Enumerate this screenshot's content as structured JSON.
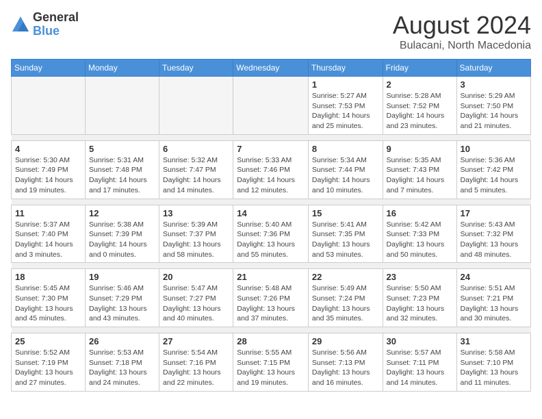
{
  "logo": {
    "general": "General",
    "blue": "Blue"
  },
  "title": "August 2024",
  "location": "Bulacani, North Macedonia",
  "days_of_week": [
    "Sunday",
    "Monday",
    "Tuesday",
    "Wednesday",
    "Thursday",
    "Friday",
    "Saturday"
  ],
  "weeks": [
    [
      {
        "day": "",
        "info": ""
      },
      {
        "day": "",
        "info": ""
      },
      {
        "day": "",
        "info": ""
      },
      {
        "day": "",
        "info": ""
      },
      {
        "day": "1",
        "info": "Sunrise: 5:27 AM\nSunset: 7:53 PM\nDaylight: 14 hours\nand 25 minutes."
      },
      {
        "day": "2",
        "info": "Sunrise: 5:28 AM\nSunset: 7:52 PM\nDaylight: 14 hours\nand 23 minutes."
      },
      {
        "day": "3",
        "info": "Sunrise: 5:29 AM\nSunset: 7:50 PM\nDaylight: 14 hours\nand 21 minutes."
      }
    ],
    [
      {
        "day": "4",
        "info": "Sunrise: 5:30 AM\nSunset: 7:49 PM\nDaylight: 14 hours\nand 19 minutes."
      },
      {
        "day": "5",
        "info": "Sunrise: 5:31 AM\nSunset: 7:48 PM\nDaylight: 14 hours\nand 17 minutes."
      },
      {
        "day": "6",
        "info": "Sunrise: 5:32 AM\nSunset: 7:47 PM\nDaylight: 14 hours\nand 14 minutes."
      },
      {
        "day": "7",
        "info": "Sunrise: 5:33 AM\nSunset: 7:46 PM\nDaylight: 14 hours\nand 12 minutes."
      },
      {
        "day": "8",
        "info": "Sunrise: 5:34 AM\nSunset: 7:44 PM\nDaylight: 14 hours\nand 10 minutes."
      },
      {
        "day": "9",
        "info": "Sunrise: 5:35 AM\nSunset: 7:43 PM\nDaylight: 14 hours\nand 7 minutes."
      },
      {
        "day": "10",
        "info": "Sunrise: 5:36 AM\nSunset: 7:42 PM\nDaylight: 14 hours\nand 5 minutes."
      }
    ],
    [
      {
        "day": "11",
        "info": "Sunrise: 5:37 AM\nSunset: 7:40 PM\nDaylight: 14 hours\nand 3 minutes."
      },
      {
        "day": "12",
        "info": "Sunrise: 5:38 AM\nSunset: 7:39 PM\nDaylight: 14 hours\nand 0 minutes."
      },
      {
        "day": "13",
        "info": "Sunrise: 5:39 AM\nSunset: 7:37 PM\nDaylight: 13 hours\nand 58 minutes."
      },
      {
        "day": "14",
        "info": "Sunrise: 5:40 AM\nSunset: 7:36 PM\nDaylight: 13 hours\nand 55 minutes."
      },
      {
        "day": "15",
        "info": "Sunrise: 5:41 AM\nSunset: 7:35 PM\nDaylight: 13 hours\nand 53 minutes."
      },
      {
        "day": "16",
        "info": "Sunrise: 5:42 AM\nSunset: 7:33 PM\nDaylight: 13 hours\nand 50 minutes."
      },
      {
        "day": "17",
        "info": "Sunrise: 5:43 AM\nSunset: 7:32 PM\nDaylight: 13 hours\nand 48 minutes."
      }
    ],
    [
      {
        "day": "18",
        "info": "Sunrise: 5:45 AM\nSunset: 7:30 PM\nDaylight: 13 hours\nand 45 minutes."
      },
      {
        "day": "19",
        "info": "Sunrise: 5:46 AM\nSunset: 7:29 PM\nDaylight: 13 hours\nand 43 minutes."
      },
      {
        "day": "20",
        "info": "Sunrise: 5:47 AM\nSunset: 7:27 PM\nDaylight: 13 hours\nand 40 minutes."
      },
      {
        "day": "21",
        "info": "Sunrise: 5:48 AM\nSunset: 7:26 PM\nDaylight: 13 hours\nand 37 minutes."
      },
      {
        "day": "22",
        "info": "Sunrise: 5:49 AM\nSunset: 7:24 PM\nDaylight: 13 hours\nand 35 minutes."
      },
      {
        "day": "23",
        "info": "Sunrise: 5:50 AM\nSunset: 7:23 PM\nDaylight: 13 hours\nand 32 minutes."
      },
      {
        "day": "24",
        "info": "Sunrise: 5:51 AM\nSunset: 7:21 PM\nDaylight: 13 hours\nand 30 minutes."
      }
    ],
    [
      {
        "day": "25",
        "info": "Sunrise: 5:52 AM\nSunset: 7:19 PM\nDaylight: 13 hours\nand 27 minutes."
      },
      {
        "day": "26",
        "info": "Sunrise: 5:53 AM\nSunset: 7:18 PM\nDaylight: 13 hours\nand 24 minutes."
      },
      {
        "day": "27",
        "info": "Sunrise: 5:54 AM\nSunset: 7:16 PM\nDaylight: 13 hours\nand 22 minutes."
      },
      {
        "day": "28",
        "info": "Sunrise: 5:55 AM\nSunset: 7:15 PM\nDaylight: 13 hours\nand 19 minutes."
      },
      {
        "day": "29",
        "info": "Sunrise: 5:56 AM\nSunset: 7:13 PM\nDaylight: 13 hours\nand 16 minutes."
      },
      {
        "day": "30",
        "info": "Sunrise: 5:57 AM\nSunset: 7:11 PM\nDaylight: 13 hours\nand 14 minutes."
      },
      {
        "day": "31",
        "info": "Sunrise: 5:58 AM\nSunset: 7:10 PM\nDaylight: 13 hours\nand 11 minutes."
      }
    ]
  ]
}
